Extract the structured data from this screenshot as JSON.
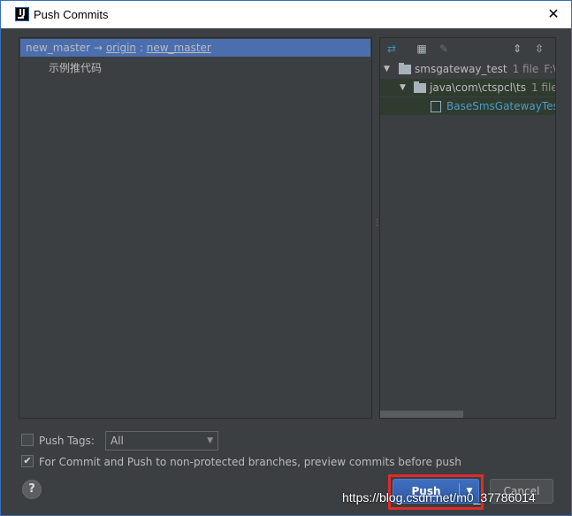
{
  "window": {
    "title": "Push Commits",
    "app_icon_letter": "IJ"
  },
  "branch_row": {
    "local": "new_master",
    "arrow": "→",
    "remote": "origin",
    "colon": ":",
    "remote_branch": "new_master"
  },
  "commits": [
    {
      "message": "示例推代码"
    }
  ],
  "tree": {
    "root": {
      "name": "smsgateway_test",
      "count": "1 file",
      "path": "F:\\u"
    },
    "folder": {
      "name": "java\\com\\ctspcl\\ts",
      "count": "1 file"
    },
    "file": {
      "name": "BaseSmsGatewayTest"
    }
  },
  "push_tags": {
    "label": "Push Tags:",
    "select_value": "All",
    "checked": false
  },
  "preview_option": {
    "label": "For Commit and Push to non-protected branches, preview commits before push",
    "checked": true
  },
  "buttons": {
    "push": "Push",
    "cancel": "Cancel",
    "help": "?"
  },
  "watermark": "https://blog.csdn.net/m0_37786014",
  "colors": {
    "selection": "#4b6eaf",
    "panel_bg": "#3c3f41",
    "push_button": "#365f9f",
    "highlight_box": "#e02b2b"
  }
}
